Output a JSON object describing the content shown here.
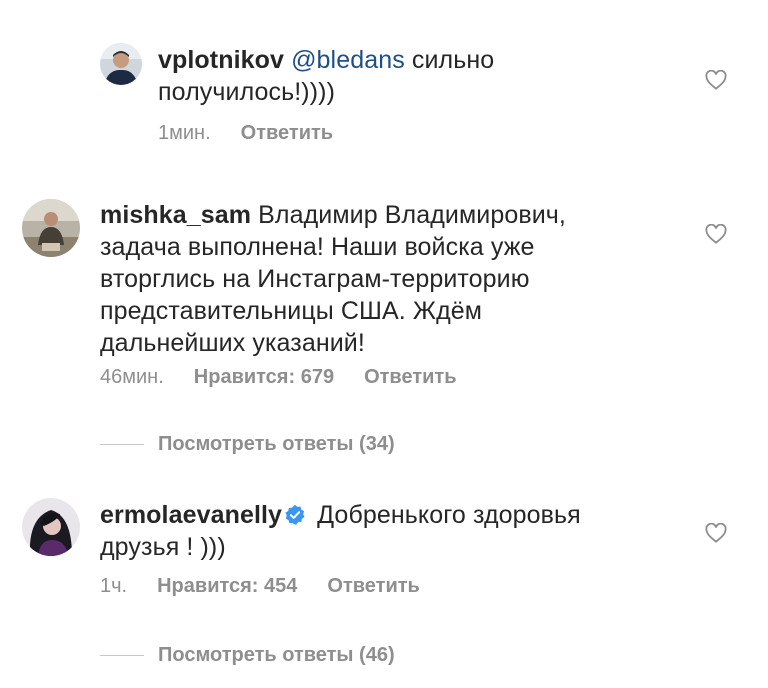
{
  "comments": [
    {
      "username": "vplotnikov",
      "mention": "@bledans",
      "text_line1": "сильно",
      "text_line2": "получилось!))))",
      "time": "1мин.",
      "reply_label": "Ответить"
    },
    {
      "username": "mishka_sam",
      "text_lines": [
        "Владимир Владимирович,",
        "задача выполнена! Наши войска уже",
        "вторглись на Инстаграм-территорию",
        "представительницы США. Ждём",
        "дальнейших указаний!"
      ],
      "time": "46мин.",
      "likes": "Нравится: 679",
      "reply_label": "Ответить",
      "view_replies": "Посмотреть ответы (34)"
    },
    {
      "username": "ermolaevanelly",
      "verified": true,
      "text_line1": "Добренького здоровья",
      "text_line2": "друзья ! )))",
      "time": "1ч.",
      "likes": "Нравится: 454",
      "reply_label": "Ответить",
      "view_replies": "Посмотреть ответы (46)"
    }
  ],
  "colors": {
    "text": "#262626",
    "meta": "#8e8e8e",
    "mention": "#1f4f86",
    "verified": "#3897f0"
  }
}
